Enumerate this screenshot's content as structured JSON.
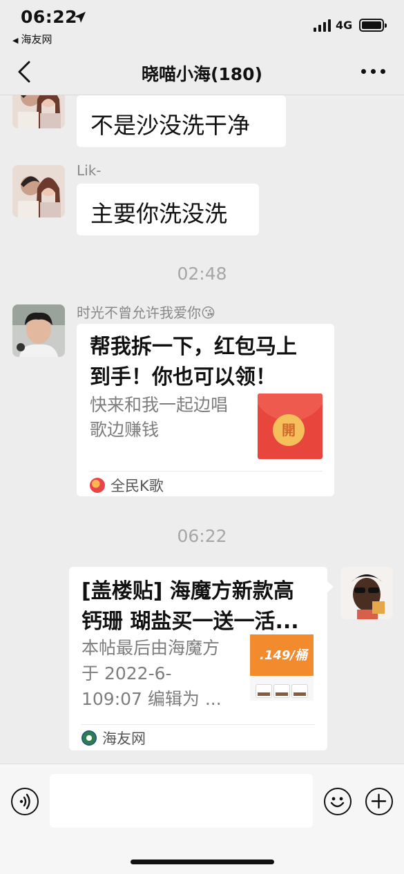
{
  "status_bar": {
    "time": "06:22",
    "back_app": "海友网",
    "network": "4G"
  },
  "nav": {
    "title": "晓喵小海(180)",
    "back_icon": "chevron-left-icon",
    "more_icon": "more-dots-icon"
  },
  "messages": {
    "m1_text": "不是沙没洗干净",
    "m2_sender": "Lik-",
    "m2_text": "主要你洗没洗",
    "time1": "02:48",
    "m3_sender": "时光不曾允许我爱你😘",
    "m3_card": {
      "title_line1": "帮我拆一下，红包马上",
      "title_line2": "到手！你也可以领！",
      "desc_line1": "快来和我一起边唱",
      "desc_line2": "歌边赚钱",
      "coin_label": "開",
      "source": "全民K歌"
    },
    "time2": "06:22",
    "m4_card": {
      "title_line1": "[盖楼贴] 海魔方新款高",
      "title_line2": "钙珊 瑚盐买一送一活...",
      "desc_line1": "本帖最后由海魔方",
      "desc_line2": "于 2022-6-",
      "desc_line3": "109:07 编辑为 ...",
      "thumb_price": ".149/桶",
      "source": "海友网"
    }
  },
  "input_bar": {
    "voice_icon": "voice-icon",
    "emoji_icon": "emoji-icon",
    "plus_icon": "plus-icon",
    "message_value": ""
  },
  "colors": {
    "background": "#ededed",
    "bubble": "#ffffff",
    "red_packet": "#e8453c",
    "coin": "#f5c05c"
  }
}
